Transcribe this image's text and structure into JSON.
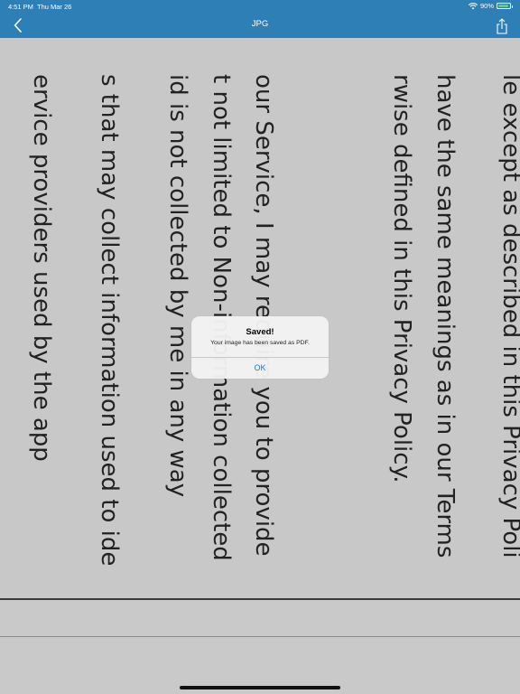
{
  "status_bar": {
    "time": "4:51 PM",
    "date": "Thu Mar 26",
    "battery_percent": "90%",
    "battery_level": 0.9,
    "wifi_icon": "wifi-icon",
    "battery_icon": "battery-icon"
  },
  "nav": {
    "title": "JPG",
    "back_icon": "chevron-left-icon",
    "share_icon": "share-icon"
  },
  "document_lines": [
    "le except as described in this Privacy Poli",
    "have the same meanings as in our Terms",
    "rwise defined in this Privacy Policy.",
    "our Service, I may require you to provide",
    "t not limited to Non-information collected",
    "id is not collected by me in any way",
    "s that may collect information used to ide",
    "ervice providers used by the app"
  ],
  "alert": {
    "title": "Saved!",
    "message": "Your image has been saved as PDF.",
    "ok_label": "OK"
  },
  "colors": {
    "bar": "#2d7fb5",
    "accent": "#1a7fd4",
    "background": "#c8c8c8"
  }
}
